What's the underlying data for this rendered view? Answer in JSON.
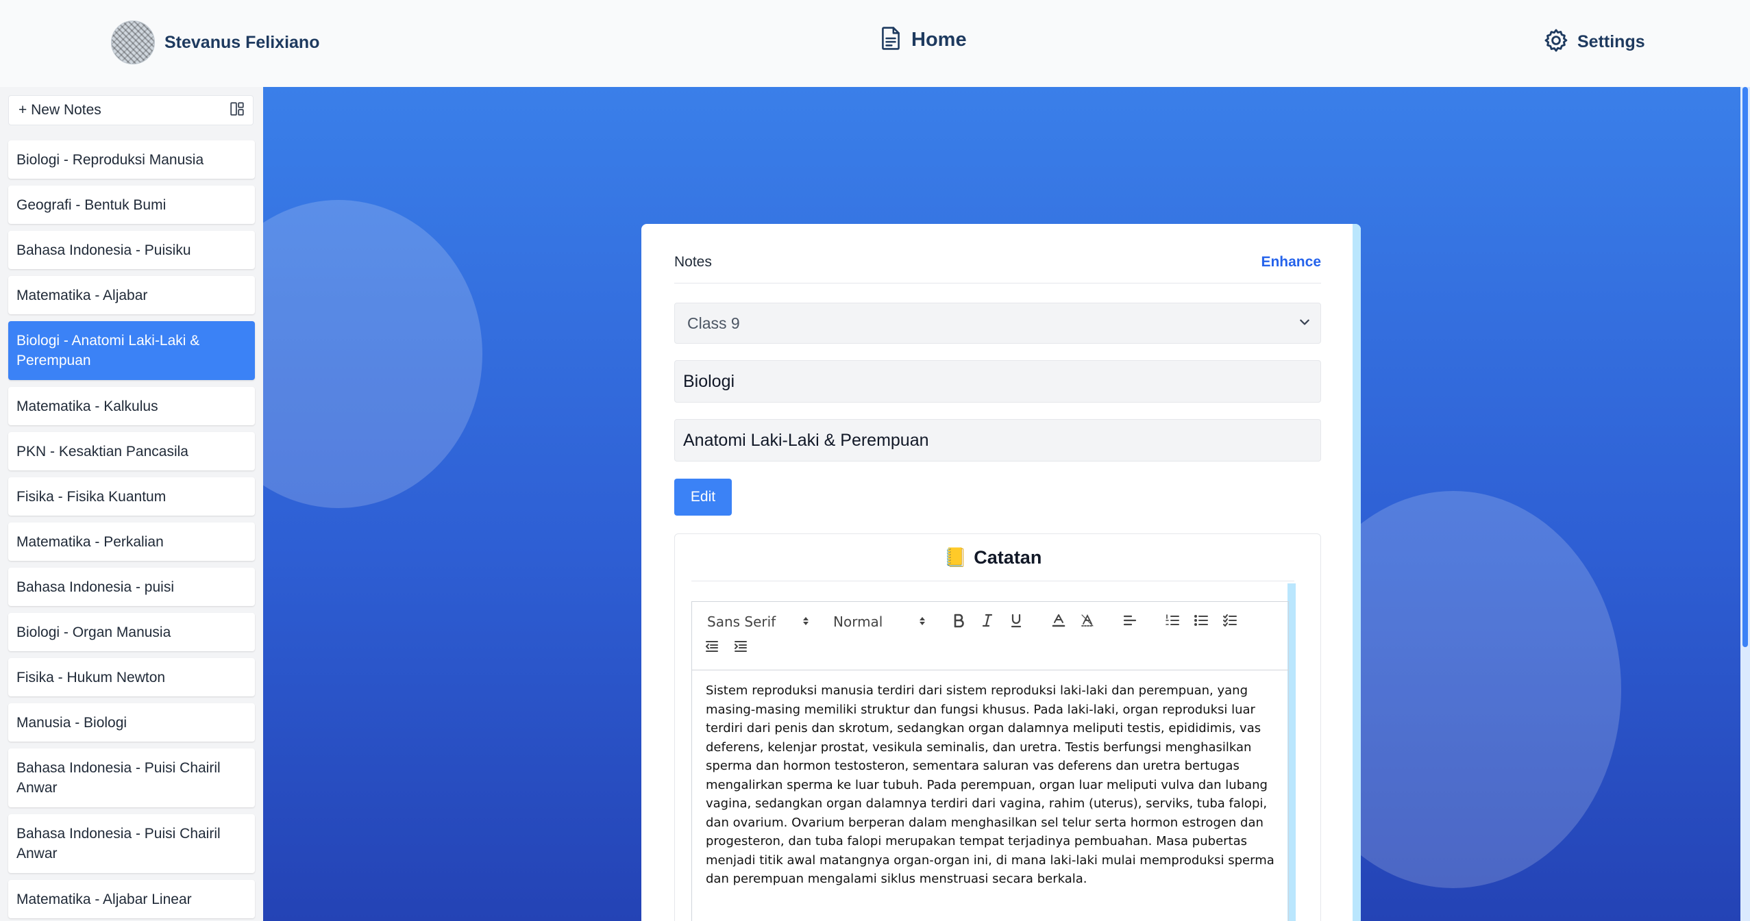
{
  "header": {
    "user_name": "Stevanus Felixiano",
    "home_label": "Home",
    "settings_label": "Settings"
  },
  "sidebar": {
    "new_notes_label": "+ New Notes",
    "notes": [
      {
        "label": "Biologi - Reproduksi Manusia",
        "active": false
      },
      {
        "label": "Geografi - Bentuk Bumi",
        "active": false
      },
      {
        "label": "Bahasa Indonesia - Puisiku",
        "active": false
      },
      {
        "label": "Matematika - Aljabar",
        "active": false
      },
      {
        "label": "Biologi - Anatomi Laki-Laki & Perempuan",
        "active": true
      },
      {
        "label": "Matematika - Kalkulus",
        "active": false
      },
      {
        "label": "PKN - Kesaktian Pancasila",
        "active": false
      },
      {
        "label": "Fisika - Fisika Kuantum",
        "active": false
      },
      {
        "label": "Matematika - Perkalian",
        "active": false
      },
      {
        "label": "Bahasa Indonesia - puisi",
        "active": false
      },
      {
        "label": "Biologi - Organ Manusia",
        "active": false
      },
      {
        "label": "Fisika - Hukum Newton",
        "active": false
      },
      {
        "label": "Manusia - Biologi",
        "active": false
      },
      {
        "label": "Bahasa Indonesia - Puisi Chairil Anwar",
        "active": false
      },
      {
        "label": "Bahasa Indonesia - Puisi Chairil Anwar",
        "active": false
      },
      {
        "label": "Matematika - Aljabar Linear",
        "active": false
      }
    ]
  },
  "form": {
    "title": "Notes",
    "enhance_label": "Enhance",
    "class_value": "Class 9",
    "subject_value": "Biologi",
    "topic_value": "Anatomi Laki-Laki & Perempuan",
    "edit_label": "Edit"
  },
  "catatan": {
    "emoji": "📒",
    "title": "Catatan",
    "toolbar": {
      "font_value": "Sans Serif",
      "size_value": "Normal"
    },
    "content": "Sistem reproduksi manusia terdiri dari sistem reproduksi laki-laki dan perempuan, yang masing-masing memiliki struktur dan fungsi khusus. Pada laki-laki, organ reproduksi luar terdiri dari penis dan skrotum, sedangkan organ dalamnya meliputi testis, epididimis, vas deferens, kelenjar prostat, vesikula seminalis, dan uretra. Testis berfungsi menghasilkan sperma dan hormon testosteron, sementara saluran vas deferens dan uretra bertugas mengalirkan sperma ke luar tubuh. Pada perempuan, organ luar meliputi vulva dan lubang vagina, sedangkan organ dalamnya terdiri dari vagina, rahim (uterus), serviks, tuba falopi, dan ovarium. Ovarium berperan dalam menghasilkan sel telur serta hormon estrogen dan progesteron, dan tuba falopi merupakan tempat terjadinya pembuahan. Masa pubertas menjadi titik awal matangnya organ-organ ini, di mana laki-laki mulai memproduksi sperma dan perempuan mengalami siklus menstruasi secara berkala."
  },
  "colors": {
    "accent": "#3b82f6",
    "heading": "#1e3a5f",
    "main_bg_top": "#3a7fe9",
    "main_bg_bottom": "#2443b5"
  },
  "icons": {
    "home": "document-icon",
    "settings": "gear-icon",
    "layout_toggle": "layout-icon"
  }
}
